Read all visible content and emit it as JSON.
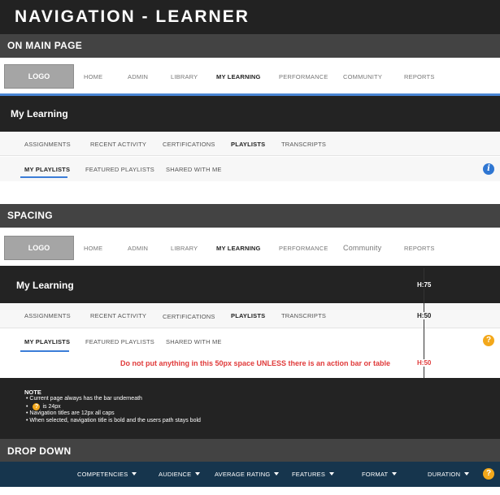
{
  "page_title": "NAVIGATION - LEARNER",
  "sections": {
    "main": "ON MAIN PAGE",
    "spacing": "SPACING",
    "dropdown": "DROP DOWN"
  },
  "nav1": {
    "logo": "LOGO",
    "items": [
      "HOME",
      "ADMIN",
      "LIBRARY",
      "MY LEARNING",
      "PERFORMANCE",
      "COMMUNITY",
      "REPORTS"
    ]
  },
  "nav2": {
    "logo": "LOGO",
    "items": [
      "HOME",
      "ADMIN",
      "LIBRARY",
      "MY LEARNING",
      "PERFORMANCE",
      "Community",
      "REPORTS"
    ]
  },
  "learning_title": "My Learning",
  "tabs": [
    "ASSIGNMENTS",
    "RECENT ACTIVITY",
    "CERTIFICATIONS",
    "PLAYLISTS",
    "TRANSCRIPTS"
  ],
  "subtabs": [
    "MY PLAYLISTS",
    "FEATURED PLAYLISTS",
    "SHARED WITH ME"
  ],
  "icons": {
    "info": "i",
    "help": "?"
  },
  "measures": {
    "h75": "H:75",
    "h50a": "H:50",
    "h50b": "H:50"
  },
  "spacing_warning": "Do not put anything in this 50px space UNLESS there is an action bar or table",
  "note": {
    "title": "NOTE",
    "line1": "• Current page always has the bar underneath",
    "line2_pre": "•",
    "line2_post": "is 24px",
    "line3": "• Navigation titles are 12px all caps",
    "line4": "• When selected, navigation title is bold and the users path stays bold"
  },
  "dropdowns": [
    "COMPETENCIES",
    "AUDIENCE",
    "AVERAGE RATING",
    "FEATURES",
    "FORMAT",
    "DURATION"
  ],
  "colors": {
    "accent_blue": "#3b7dd8",
    "warning_red": "#e03a3a",
    "help_orange": "#f3a81b",
    "dropdown_bg": "#16354d"
  }
}
